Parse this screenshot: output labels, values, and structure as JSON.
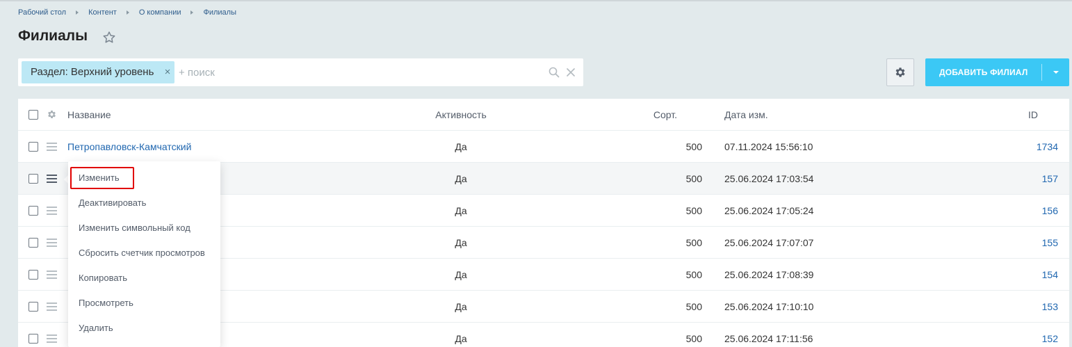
{
  "breadcrumb": [
    "Рабочий стол",
    "Контент",
    "О компании",
    "Филиалы"
  ],
  "page": {
    "title": "Филиалы"
  },
  "filter": {
    "tag": "Раздел: Верхний уровень",
    "tag_close": "×",
    "placeholder": "+ поиск"
  },
  "toolbar": {
    "add_label": "ДОБАВИТЬ ФИЛИАЛ"
  },
  "table": {
    "headers": {
      "name": "Название",
      "active": "Активность",
      "sort": "Сорт.",
      "date": "Дата изм.",
      "id": "ID"
    },
    "rows": [
      {
        "name": "Петропавловск-Камчатский",
        "active": "Да",
        "sort": "500",
        "date": "07.11.2024 15:56:10",
        "id": "1734"
      },
      {
        "name": "",
        "active": "Да",
        "sort": "500",
        "date": "25.06.2024 17:03:54",
        "id": "157"
      },
      {
        "name": "",
        "active": "Да",
        "sort": "500",
        "date": "25.06.2024 17:05:24",
        "id": "156"
      },
      {
        "name": "",
        "active": "Да",
        "sort": "500",
        "date": "25.06.2024 17:07:07",
        "id": "155"
      },
      {
        "name": "",
        "active": "Да",
        "sort": "500",
        "date": "25.06.2024 17:08:39",
        "id": "154"
      },
      {
        "name": "",
        "active": "Да",
        "sort": "500",
        "date": "25.06.2024 17:10:10",
        "id": "153"
      },
      {
        "name": "",
        "active": "Да",
        "sort": "500",
        "date": "25.06.2024 17:11:56",
        "id": "152"
      }
    ]
  },
  "context_menu": {
    "items": [
      "Изменить",
      "Деактивировать",
      "Изменить символьный код",
      "Сбросить счетчик просмотров",
      "Копировать",
      "Просмотреть",
      "Удалить"
    ]
  },
  "colors": {
    "accent": "#3bc8f5",
    "tag_bg": "#bce8f5",
    "link": "#2067b0",
    "highlight": "#e10000",
    "page_bg": "#e2eaec"
  }
}
